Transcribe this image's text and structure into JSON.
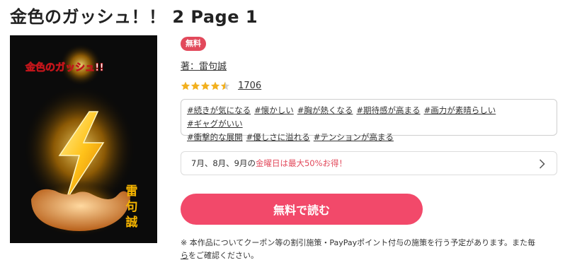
{
  "page": {
    "title": "金色のガッシュ！！ 2 Page 1"
  },
  "cover": {
    "title_text": "金色のガッシュ!!",
    "author_vertical": [
      "雷",
      "句",
      "誠"
    ],
    "accent_color": "#f5b400"
  },
  "book": {
    "badge": "無料",
    "author": "著：雷句誠",
    "rating_stars": 4.5,
    "rating_count": "1706",
    "tags": [
      "#続きが気になる",
      "#懐かしい",
      "#胸が熱くなる",
      "#期待感が高まる",
      "#画力が素晴らしい",
      "#ギャグがいい",
      "#衝撃的な展開",
      "#優しさに溢れる",
      "#テンションが高まる"
    ]
  },
  "promo": {
    "prefix": "7月、8月、9月の",
    "highlight": "金曜日は最大50%お得！",
    "chevron_icon": "chevron-right-icon"
  },
  "action": {
    "read_label": "無料で読む",
    "button_color": "#f2496a"
  },
  "notice": {
    "line1": "※ 本作品についてクーポン等の割引施策・PayPayポイント付与の施策を行う予定があります。また毎",
    "line2_link": "ら",
    "line2_rest": "をご確認ください。"
  }
}
